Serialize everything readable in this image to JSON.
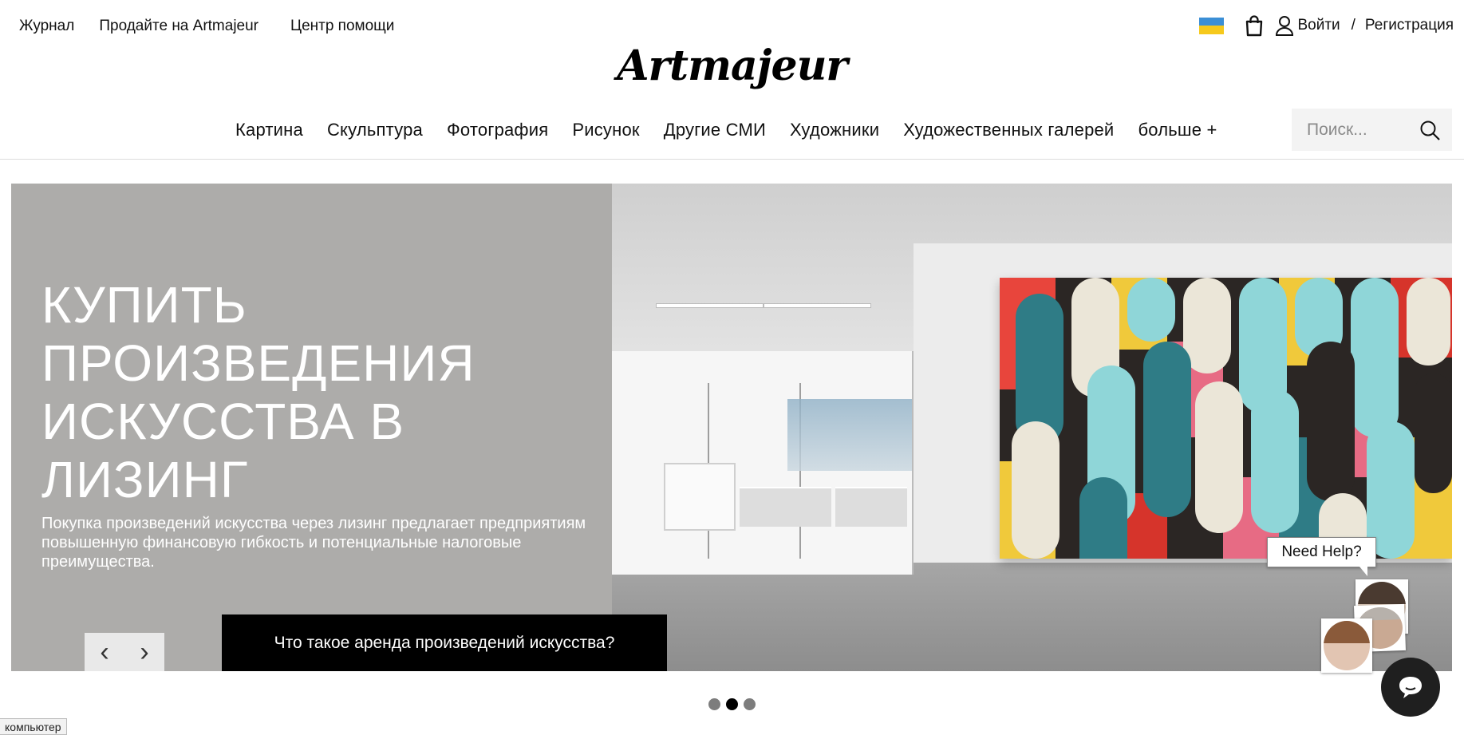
{
  "top_links": {
    "journal": "Журнал",
    "sell": "Продайте на Artmajeur",
    "help": "Центр помощи"
  },
  "account": {
    "login": "Войти",
    "separator": "/",
    "register": "Регистрация"
  },
  "logo": "Artmajeur",
  "nav": {
    "items": [
      "Картина",
      "Скульптура",
      "Фотография",
      "Рисунок",
      "Другие СМИ",
      "Художники",
      "Художественных галерей",
      "больше +"
    ]
  },
  "search": {
    "placeholder": "Поиск..."
  },
  "hero": {
    "title": "КУПИТЬ ПРОИЗВЕДЕНИЯ ИСКУССТВА В ЛИЗИНГ",
    "subtitle": "Покупка произведений искусства через лизинг предлагает предприятиям повышенную финансовую гибкость и потенциальные налоговые преимущества.",
    "cta": "Что такое аренда произведений искусства?",
    "prev_glyph": "‹",
    "next_glyph": "›"
  },
  "carousel": {
    "slides": 3,
    "active_index": 1
  },
  "help_widget": {
    "label": "Need Help?"
  },
  "status_bar": "компьютер",
  "colors": {
    "hero_left_bg": "#adacaa",
    "cta_bg": "#000000",
    "flag_blue": "#3b8fd6",
    "flag_yellow": "#f6c91c"
  },
  "icons": [
    "ukraine-flag-icon",
    "shopping-bag-icon",
    "user-icon",
    "search-icon",
    "chevron-left-icon",
    "chevron-right-icon",
    "chat-bubble-icon"
  ]
}
